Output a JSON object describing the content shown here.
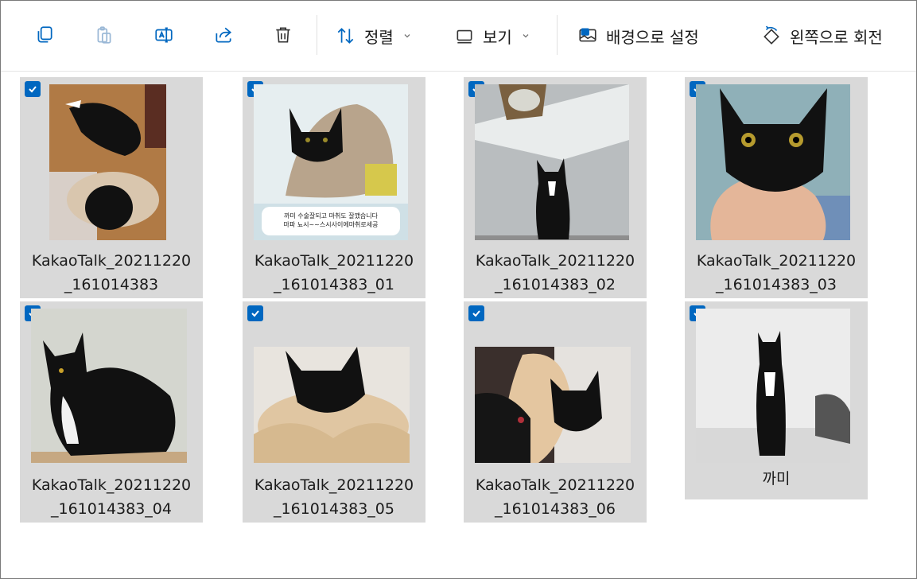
{
  "toolbar": {
    "copy_icon": "copy-icon",
    "paste_icon": "paste-icon",
    "rename_icon": "rename-icon",
    "share_icon": "share-icon",
    "delete_icon": "trash-icon",
    "sort_label": "정렬",
    "view_label": "보기",
    "set_background_label": "배경으로 설정",
    "rotate_left_label": "왼쪽으로 회전",
    "accent_color": "#0067c0"
  },
  "files": [
    {
      "line1": "KakaoTalk_20211220",
      "line2": "_161014383",
      "selected": true
    },
    {
      "line1": "KakaoTalk_20211220",
      "line2": "_161014383_01",
      "selected": true
    },
    {
      "line1": "KakaoTalk_20211220",
      "line2": "_161014383_02",
      "selected": true
    },
    {
      "line1": "KakaoTalk_20211220",
      "line2": "_161014383_03",
      "selected": true
    },
    {
      "line1": "KakaoTalk_20211220",
      "line2": "_161014383_04",
      "selected": true
    },
    {
      "line1": "KakaoTalk_20211220",
      "line2": "_161014383_05",
      "selected": true
    },
    {
      "line1": "KakaoTalk_20211220",
      "line2": "_161014383_06",
      "selected": true
    },
    {
      "line1": "까미",
      "line2": "",
      "selected": true
    }
  ],
  "thumb_captions": {
    "caption_line1": "까미 수술잘되고 마취도 잘깼습니다",
    "caption_line2": "마파 뇨시~~스시사이에마취로세공"
  }
}
